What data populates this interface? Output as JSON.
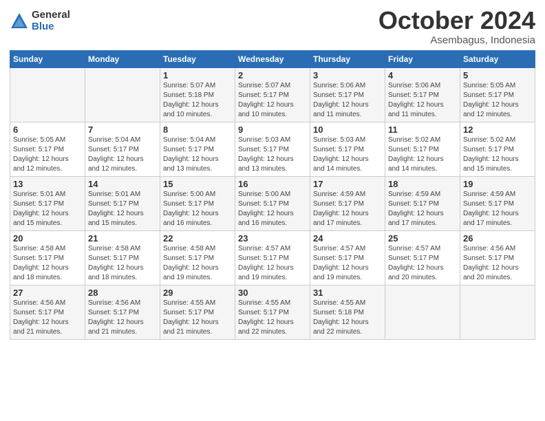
{
  "logo": {
    "general": "General",
    "blue": "Blue"
  },
  "title": "October 2024",
  "subtitle": "Asembagus, Indonesia",
  "days_header": [
    "Sunday",
    "Monday",
    "Tuesday",
    "Wednesday",
    "Thursday",
    "Friday",
    "Saturday"
  ],
  "weeks": [
    [
      {
        "day": "",
        "info": ""
      },
      {
        "day": "",
        "info": ""
      },
      {
        "day": "1",
        "info": "Sunrise: 5:07 AM\nSunset: 5:18 PM\nDaylight: 12 hours\nand 10 minutes."
      },
      {
        "day": "2",
        "info": "Sunrise: 5:07 AM\nSunset: 5:17 PM\nDaylight: 12 hours\nand 10 minutes."
      },
      {
        "day": "3",
        "info": "Sunrise: 5:06 AM\nSunset: 5:17 PM\nDaylight: 12 hours\nand 11 minutes."
      },
      {
        "day": "4",
        "info": "Sunrise: 5:06 AM\nSunset: 5:17 PM\nDaylight: 12 hours\nand 11 minutes."
      },
      {
        "day": "5",
        "info": "Sunrise: 5:05 AM\nSunset: 5:17 PM\nDaylight: 12 hours\nand 12 minutes."
      }
    ],
    [
      {
        "day": "6",
        "info": "Sunrise: 5:05 AM\nSunset: 5:17 PM\nDaylight: 12 hours\nand 12 minutes."
      },
      {
        "day": "7",
        "info": "Sunrise: 5:04 AM\nSunset: 5:17 PM\nDaylight: 12 hours\nand 12 minutes."
      },
      {
        "day": "8",
        "info": "Sunrise: 5:04 AM\nSunset: 5:17 PM\nDaylight: 12 hours\nand 13 minutes."
      },
      {
        "day": "9",
        "info": "Sunrise: 5:03 AM\nSunset: 5:17 PM\nDaylight: 12 hours\nand 13 minutes."
      },
      {
        "day": "10",
        "info": "Sunrise: 5:03 AM\nSunset: 5:17 PM\nDaylight: 12 hours\nand 14 minutes."
      },
      {
        "day": "11",
        "info": "Sunrise: 5:02 AM\nSunset: 5:17 PM\nDaylight: 12 hours\nand 14 minutes."
      },
      {
        "day": "12",
        "info": "Sunrise: 5:02 AM\nSunset: 5:17 PM\nDaylight: 12 hours\nand 15 minutes."
      }
    ],
    [
      {
        "day": "13",
        "info": "Sunrise: 5:01 AM\nSunset: 5:17 PM\nDaylight: 12 hours\nand 15 minutes."
      },
      {
        "day": "14",
        "info": "Sunrise: 5:01 AM\nSunset: 5:17 PM\nDaylight: 12 hours\nand 15 minutes."
      },
      {
        "day": "15",
        "info": "Sunrise: 5:00 AM\nSunset: 5:17 PM\nDaylight: 12 hours\nand 16 minutes."
      },
      {
        "day": "16",
        "info": "Sunrise: 5:00 AM\nSunset: 5:17 PM\nDaylight: 12 hours\nand 16 minutes."
      },
      {
        "day": "17",
        "info": "Sunrise: 4:59 AM\nSunset: 5:17 PM\nDaylight: 12 hours\nand 17 minutes."
      },
      {
        "day": "18",
        "info": "Sunrise: 4:59 AM\nSunset: 5:17 PM\nDaylight: 12 hours\nand 17 minutes."
      },
      {
        "day": "19",
        "info": "Sunrise: 4:59 AM\nSunset: 5:17 PM\nDaylight: 12 hours\nand 17 minutes."
      }
    ],
    [
      {
        "day": "20",
        "info": "Sunrise: 4:58 AM\nSunset: 5:17 PM\nDaylight: 12 hours\nand 18 minutes."
      },
      {
        "day": "21",
        "info": "Sunrise: 4:58 AM\nSunset: 5:17 PM\nDaylight: 12 hours\nand 18 minutes."
      },
      {
        "day": "22",
        "info": "Sunrise: 4:58 AM\nSunset: 5:17 PM\nDaylight: 12 hours\nand 19 minutes."
      },
      {
        "day": "23",
        "info": "Sunrise: 4:57 AM\nSunset: 5:17 PM\nDaylight: 12 hours\nand 19 minutes."
      },
      {
        "day": "24",
        "info": "Sunrise: 4:57 AM\nSunset: 5:17 PM\nDaylight: 12 hours\nand 19 minutes."
      },
      {
        "day": "25",
        "info": "Sunrise: 4:57 AM\nSunset: 5:17 PM\nDaylight: 12 hours\nand 20 minutes."
      },
      {
        "day": "26",
        "info": "Sunrise: 4:56 AM\nSunset: 5:17 PM\nDaylight: 12 hours\nand 20 minutes."
      }
    ],
    [
      {
        "day": "27",
        "info": "Sunrise: 4:56 AM\nSunset: 5:17 PM\nDaylight: 12 hours\nand 21 minutes."
      },
      {
        "day": "28",
        "info": "Sunrise: 4:56 AM\nSunset: 5:17 PM\nDaylight: 12 hours\nand 21 minutes."
      },
      {
        "day": "29",
        "info": "Sunrise: 4:55 AM\nSunset: 5:17 PM\nDaylight: 12 hours\nand 21 minutes."
      },
      {
        "day": "30",
        "info": "Sunrise: 4:55 AM\nSunset: 5:17 PM\nDaylight: 12 hours\nand 22 minutes."
      },
      {
        "day": "31",
        "info": "Sunrise: 4:55 AM\nSunset: 5:18 PM\nDaylight: 12 hours\nand 22 minutes."
      },
      {
        "day": "",
        "info": ""
      },
      {
        "day": "",
        "info": ""
      }
    ]
  ]
}
